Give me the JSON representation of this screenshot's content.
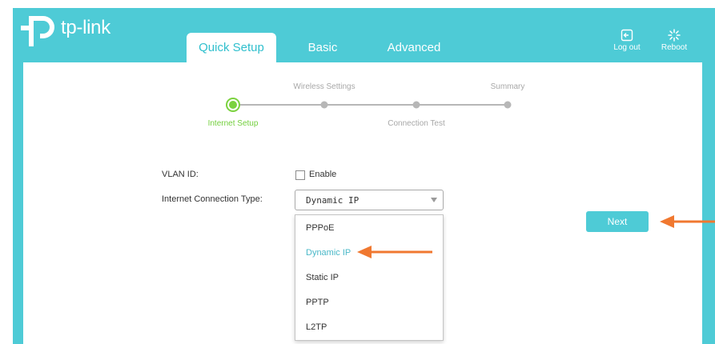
{
  "brand": {
    "logo_text": "tp-link"
  },
  "tabs": [
    {
      "label": "Quick Setup",
      "active": true
    },
    {
      "label": "Basic",
      "active": false
    },
    {
      "label": "Advanced",
      "active": false
    }
  ],
  "header_actions": {
    "logout": {
      "label": "Log out",
      "icon": "logout-icon"
    },
    "reboot": {
      "label": "Reboot",
      "icon": "reboot-icon"
    }
  },
  "stepper": {
    "steps": [
      {
        "label": "Internet Setup",
        "state": "current"
      },
      {
        "label": "Wireless Settings",
        "state": "pending"
      },
      {
        "label": "Connection Test",
        "state": "pending"
      },
      {
        "label": "Summary",
        "state": "pending"
      }
    ]
  },
  "form": {
    "vlan": {
      "label": "VLAN ID:",
      "checkbox_label": "Enable",
      "checked": false
    },
    "connection_type": {
      "label": "Internet Connection Type:",
      "value": "Dynamic IP",
      "options": [
        "PPPoE",
        "Dynamic IP",
        "Static IP",
        "PPTP",
        "L2TP"
      ],
      "selected_index": 1
    }
  },
  "buttons": {
    "next": "Next"
  },
  "colors": {
    "brand": "#4ecbd6",
    "current_step": "#7bd23f",
    "selected_option": "#4ab8c8",
    "annotation_arrow": "#f07830"
  }
}
